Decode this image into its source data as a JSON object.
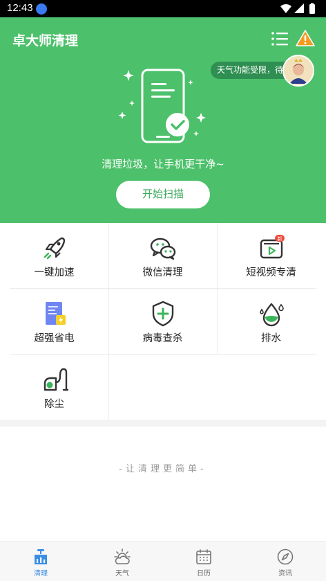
{
  "status_bar": {
    "time": "12:43"
  },
  "header": {
    "app_title": "卓大师清理",
    "weather_notice": "天气功能受限，待修复!",
    "tagline": "清理垃圾，让手机更干净~",
    "scan_button": "开始扫描"
  },
  "features": [
    {
      "label": "一键加速",
      "icon": "rocket-icon"
    },
    {
      "label": "微信清理",
      "icon": "wechat-icon"
    },
    {
      "label": "短视频专清",
      "icon": "short-video-icon",
      "badge": "新"
    },
    {
      "label": "超强省电",
      "icon": "battery-saver-icon"
    },
    {
      "label": "病毒查杀",
      "icon": "shield-plus-icon"
    },
    {
      "label": "排水",
      "icon": "water-drop-icon"
    },
    {
      "label": "除尘",
      "icon": "vacuum-icon"
    }
  ],
  "slogan": "-让清理更简单-",
  "bottom_nav": [
    {
      "label": "清理",
      "icon": "broom-icon",
      "active": true
    },
    {
      "label": "天气",
      "icon": "weather-icon",
      "active": false
    },
    {
      "label": "日历",
      "icon": "calendar-icon",
      "active": false
    },
    {
      "label": "资讯",
      "icon": "compass-icon",
      "active": false
    }
  ],
  "colors": {
    "primary_green": "#4cc06a",
    "active_blue": "#3b8ee6",
    "warning_orange": "#f39b1f"
  }
}
